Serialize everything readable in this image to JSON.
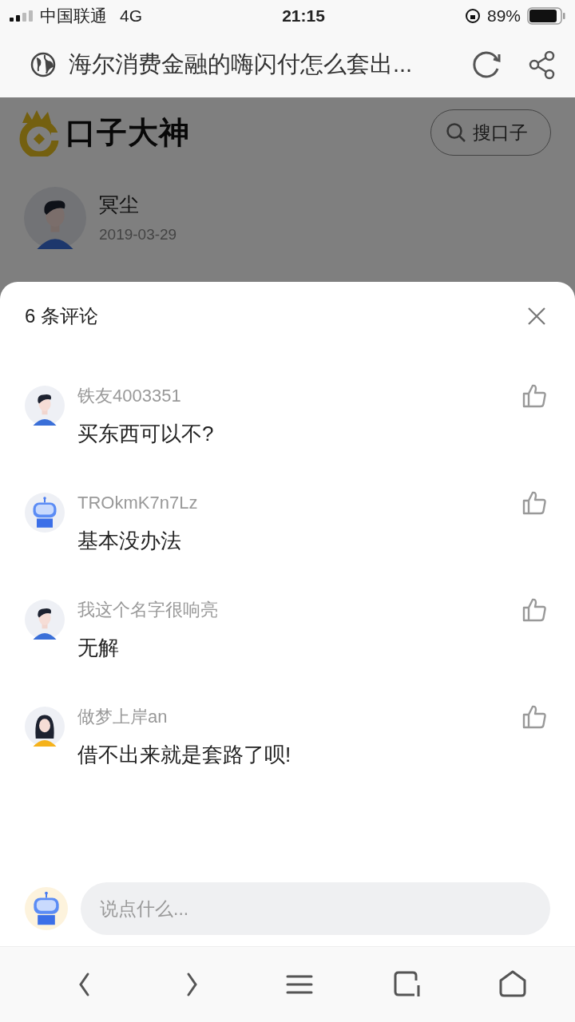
{
  "status_bar": {
    "carrier": "中国联通",
    "network": "4G",
    "time": "21:15",
    "battery": "89%"
  },
  "browser": {
    "title": "海尔消费金融的嗨闪付怎么套出..."
  },
  "page": {
    "logo": "口子大神",
    "search_button": "搜口子",
    "author": {
      "name": "冥尘",
      "date": "2019-03-29",
      "avatar": {
        "kind": "person-male"
      }
    }
  },
  "comments_sheet": {
    "title": "6 条评论",
    "comments": [
      {
        "user": "铁友4003351",
        "text": "买东西可以不?",
        "avatar": {
          "kind": "person-male"
        }
      },
      {
        "user": "TROkmK7n7Lz",
        "text": "基本没办法",
        "avatar": {
          "kind": "robot"
        }
      },
      {
        "user": "我这个名字很响亮",
        "text": "无解",
        "avatar": {
          "kind": "person-male"
        }
      },
      {
        "user": "做梦上岸an",
        "text": "借不出来就是套路了呗!",
        "avatar": {
          "kind": "person-female"
        }
      }
    ],
    "input": {
      "placeholder": "说点什么...",
      "avatar": {
        "kind": "robot"
      }
    }
  }
}
